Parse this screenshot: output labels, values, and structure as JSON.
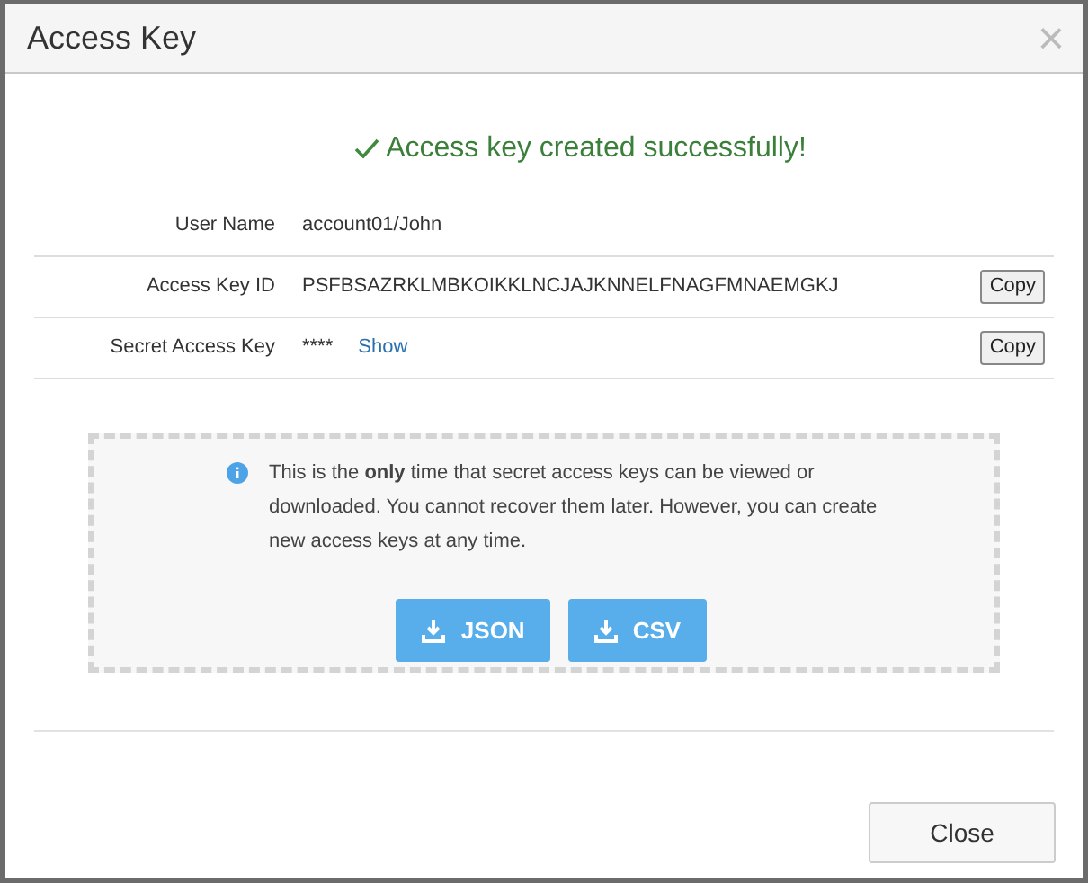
{
  "dialog": {
    "title": "Access Key",
    "close_icon": "×"
  },
  "success": "Access key created successfully!",
  "fields": [
    {
      "kind": "text",
      "label": "User Name",
      "value": "account01/John"
    },
    {
      "kind": "text",
      "label": "Access Key ID",
      "value": "PSFBSAZRKLMBKOIKKLNCJAJKNNELFNAGFMNAEMGKJ",
      "copy": "Copy"
    },
    {
      "kind": "secret",
      "label": "Secret Access Key",
      "value": "****",
      "link": "Show",
      "copy": "Copy"
    }
  ],
  "notice": "This is the **only** time that secret access keys can be viewed or downloaded. You cannot recover them later. However, you can create new access keys at any time.",
  "downloads": [
    "JSON",
    "CSV"
  ],
  "footer_button": "Close"
}
